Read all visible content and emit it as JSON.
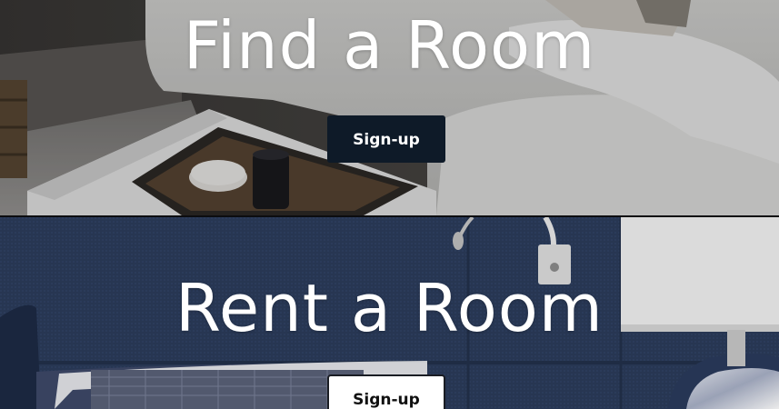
{
  "sections": [
    {
      "title": "Find a Room",
      "button_label": "Sign-up",
      "button_style": "dark",
      "button_color": "#0e1a28"
    },
    {
      "title": "Rent a Room",
      "button_label": "Sign-up",
      "button_style": "light",
      "button_color": "#ffffff"
    }
  ],
  "colors": {
    "hero_text": "#ffffff",
    "wall_navy": "#2b3b5a",
    "sofa_white": "#e4e4e2"
  }
}
